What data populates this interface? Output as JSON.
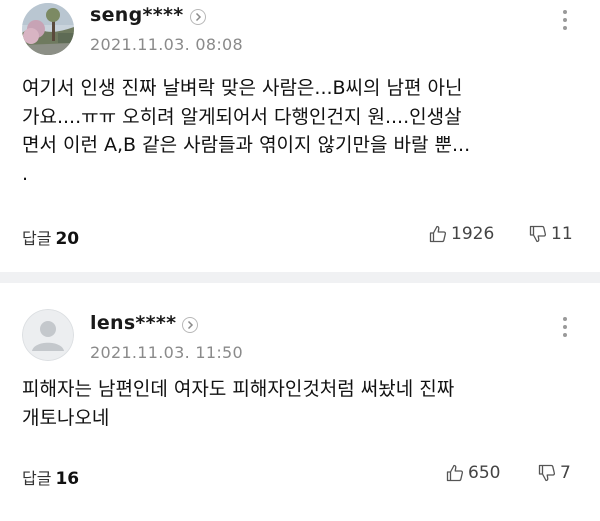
{
  "comments": [
    {
      "username": "seng****",
      "timestamp": "2021.11.03. 08:08",
      "body_lines": [
        "여기서 인생 진짜 날벼락 맞은 사람은...B씨의 남편 아닌",
        "가요....ㅠㅠ 오히려 알게되어서 다행인건지 원....인생살",
        "면서 이런 A,B 같은 사람들과 엮이지 않기만을 바랄 뿐...",
        "."
      ],
      "reply_label": "답글",
      "reply_count": "20",
      "likes": "1926",
      "dislikes": "11",
      "avatar": "landscape-photo"
    },
    {
      "username": "lens****",
      "timestamp": "2021.11.03. 11:50",
      "body_lines": [
        "피해자는 남편인데 여자도 피해자인것처럼 써놨네 진짜",
        "개토나오네"
      ],
      "reply_label": "답글",
      "reply_count": "16",
      "likes": "650",
      "dislikes": "7",
      "avatar": "default-profile"
    }
  ],
  "colors": {
    "divider": "#f0f1f3",
    "timestamp": "#8a8a8a",
    "text": "#111111"
  }
}
